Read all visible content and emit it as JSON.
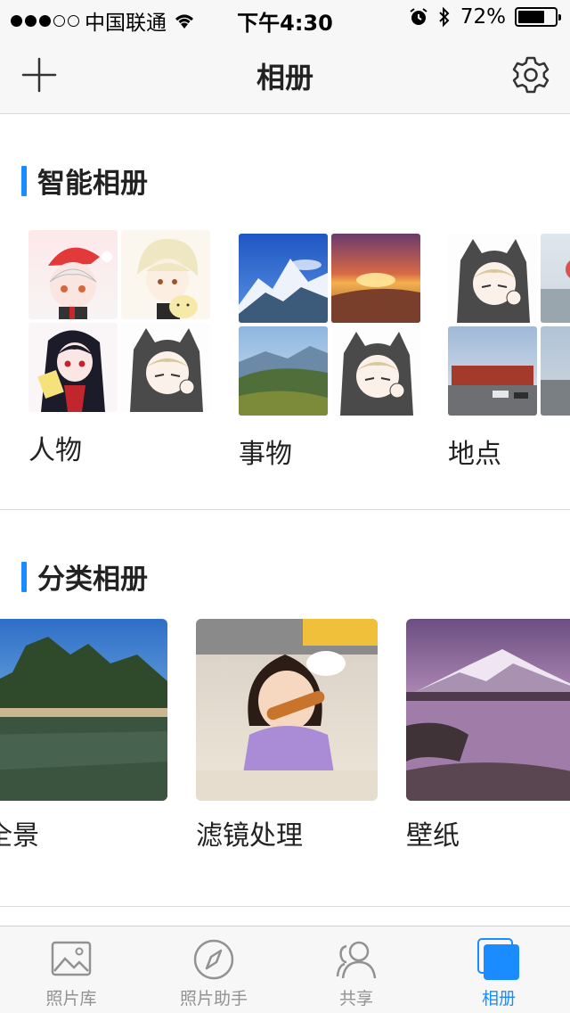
{
  "status_bar": {
    "carrier": "中国联通",
    "time": "下午4:30",
    "battery": "72%",
    "battery_level": 0.72,
    "signal_bars_filled": 3,
    "signal_bars_total": 5
  },
  "nav": {
    "title": "相册",
    "add_icon": "plus-icon",
    "settings_icon": "gear-icon"
  },
  "smart_albums": {
    "title": "智能相册",
    "items": [
      {
        "label": "人物"
      },
      {
        "label": "事物"
      },
      {
        "label": "地点"
      }
    ]
  },
  "category_albums": {
    "title": "分类相册",
    "items": [
      {
        "label": "全景"
      },
      {
        "label": "滤镜处理"
      },
      {
        "label": "壁纸"
      }
    ]
  },
  "tabs": [
    {
      "label": "照片库",
      "icon": "photo-library-icon",
      "active": false
    },
    {
      "label": "照片助手",
      "icon": "compass-icon",
      "active": false
    },
    {
      "label": "共享",
      "icon": "people-icon",
      "active": false
    },
    {
      "label": "相册",
      "icon": "albums-icon",
      "active": true
    }
  ],
  "colors": {
    "accent": "#1a8cff",
    "tab_inactive": "#929292"
  }
}
